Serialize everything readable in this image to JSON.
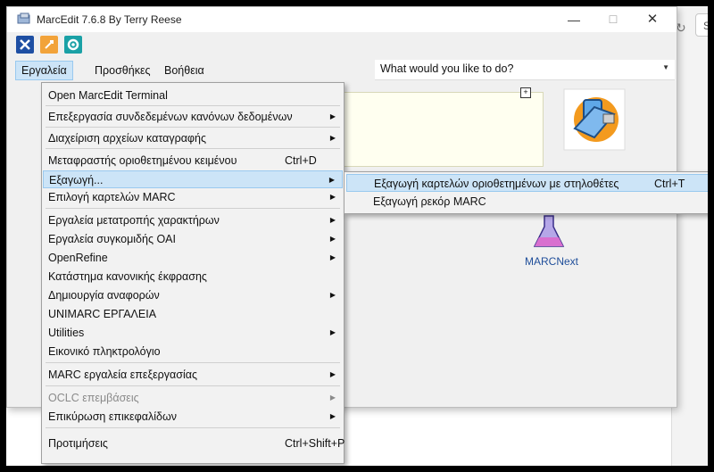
{
  "window": {
    "title": "MarcEdit 7.6.8 By Terry Reese"
  },
  "background_window": {
    "search_text": "Se"
  },
  "menubar": [
    "Εργαλεία",
    "Προσθήκες",
    "Βοήθεια"
  ],
  "search": {
    "value": "What would you like to do?"
  },
  "plus_label": "+",
  "marcnext_label": "MARCNext",
  "tools_menu": [
    {
      "label": "Open MarcEdit Terminal",
      "shortcut": "",
      "submenu": false
    },
    {
      "label": "Επεξεργασία συνδεδεμένων κανόνων δεδομένων",
      "shortcut": "",
      "submenu": true
    },
    {
      "label": "Διαχείριση αρχείων καταγραφής",
      "shortcut": "",
      "submenu": true
    },
    {
      "label": "Μεταφραστής οριοθετημένου κειμένου",
      "shortcut": "Ctrl+D",
      "submenu": false
    },
    {
      "label": "Εξαγωγή...",
      "shortcut": "",
      "submenu": true
    },
    {
      "label": "Επιλογή καρτελών MARC",
      "shortcut": "",
      "submenu": true
    },
    {
      "label": "Εργαλεία μετατροπής χαρακτήρων",
      "shortcut": "",
      "submenu": true
    },
    {
      "label": "Εργαλεία συγκομιδής OAI",
      "shortcut": "",
      "submenu": true
    },
    {
      "label": "OpenRefine",
      "shortcut": "",
      "submenu": true
    },
    {
      "label": "Κατάστημα κανονικής έκφρασης",
      "shortcut": "",
      "submenu": false
    },
    {
      "label": "Δημιουργία αναφορών",
      "shortcut": "",
      "submenu": true
    },
    {
      "label": "UNIMARC ΕΡΓΑΛΕΙΑ",
      "shortcut": "",
      "submenu": false
    },
    {
      "label": "Utilities",
      "shortcut": "",
      "submenu": true
    },
    {
      "label": "Εικονικό πληκτρολόγιο",
      "shortcut": "",
      "submenu": false
    },
    {
      "label": "MARC εργαλεία επεξεργασίας",
      "shortcut": "",
      "submenu": true
    },
    {
      "label": "OCLC επεμβάσεις",
      "shortcut": "",
      "submenu": true
    },
    {
      "label": "Επικύρωση επικεφαλίδων",
      "shortcut": "",
      "submenu": true
    },
    {
      "label": "Προτιμήσεις",
      "shortcut": "Ctrl+Shift+P",
      "submenu": false
    }
  ],
  "export_submenu": [
    {
      "label": "Εξαγωγή καρτελών οριοθετημένων με στηλοθέτες",
      "shortcut": "Ctrl+T"
    },
    {
      "label": "Εξαγωγή ρεκόρ MARC",
      "shortcut": ""
    }
  ],
  "glyphs": {
    "submenu_arrow": "▶",
    "dropdown_arrow": "▼",
    "minimize": "—",
    "maximize": "☐",
    "close": "✕",
    "refresh": "↻"
  },
  "colors": {
    "highlight_bg": "#cce4f7",
    "highlight_border": "#99c9ef",
    "link": "#1f4e9a",
    "disabled": "#8a8a8a"
  }
}
